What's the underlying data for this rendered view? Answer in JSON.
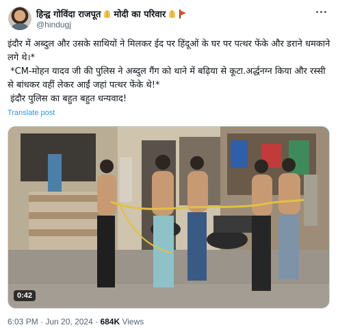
{
  "author": {
    "display_name": "हिन्द्व गोविंदा राजपूत",
    "display_name_suffix": "मोदी का परिवार",
    "handle": "@hindugj"
  },
  "tweet": {
    "line1": "इंदौर में अब्दुल और उसके साथियों ने मिलकर ईद पर हिंदूओं के घर पर पत्थर फेंके और डराने धमकाने लगे थे।*",
    "line2": " *CM-मोहन यादव जी की पुलिस ने अब्दुल गैंग को थाने में बढ़िया से कूटा.अर्द्धनग्न किया और रस्सी से बांधकर वहीं लेकर आईं जहां पत्थर फेंके थे!*",
    "line3": " इंदौर पुलिस का बहुत बहुत धन्यवाद!"
  },
  "translate_label": "Translate post",
  "media": {
    "type": "video",
    "duration": "0:42"
  },
  "meta": {
    "time": "6:03 PM",
    "separator1": " · ",
    "date": "Jun 20, 2024",
    "separator2": " · ",
    "views_count": "684K",
    "views_label": " Views"
  },
  "colors": {
    "link": "#1d9bf0",
    "secondary_text": "#536471",
    "primary_text": "#0f1419"
  },
  "icons": [
    "folded-hands-icon",
    "red-flag-icon",
    "more-options-icon"
  ]
}
